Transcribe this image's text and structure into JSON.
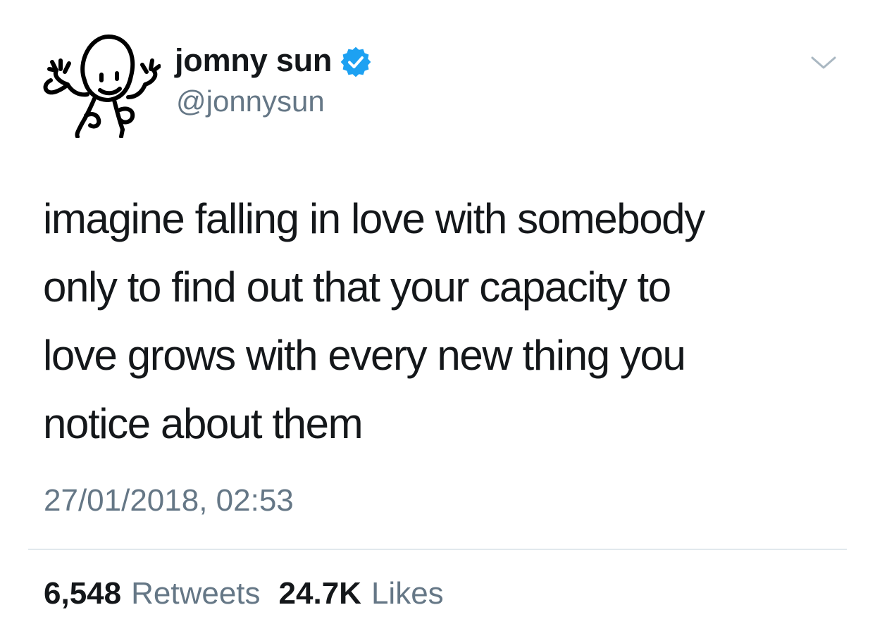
{
  "author": {
    "display_name": "jomny sun",
    "handle": "@jonnysun",
    "verified": true,
    "verified_color": "#1da1f2",
    "avatar_icon": "doodle-character-avatar-icon"
  },
  "header": {
    "menu_icon": "chevron-down-icon"
  },
  "tweet": {
    "text_lines": [
      "imagine falling in love with somebody",
      "only to find out that your capacity to",
      "love grows with every new thing you",
      "notice about them"
    ],
    "timestamp": "27/01/2018, 02:53"
  },
  "stats": {
    "retweets_count": "6,548",
    "retweets_label": "Retweets",
    "likes_count": "24.7K",
    "likes_label": "Likes"
  },
  "colors": {
    "text_primary": "#14171a",
    "text_secondary": "#657786",
    "divider": "#e1e8ed",
    "chevron": "#aab8c2"
  }
}
